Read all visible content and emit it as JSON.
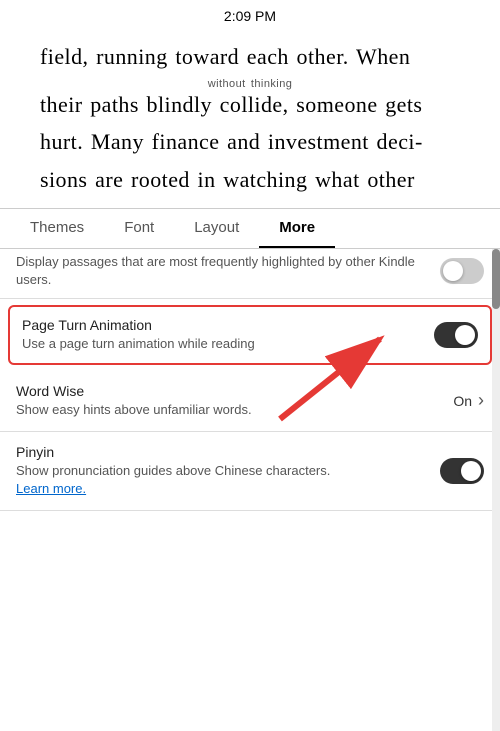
{
  "statusBar": {
    "time": "2:09 PM"
  },
  "bookContent": {
    "line1": "field, running toward each other. When",
    "annotation": "without thinking",
    "line2": "their paths blindly collide, someone gets",
    "line3": "hurt. Many finance and investment deci-",
    "line4": "sions are rooted in watching what other"
  },
  "tabs": {
    "items": [
      {
        "label": "Themes",
        "active": false
      },
      {
        "label": "Font",
        "active": false
      },
      {
        "label": "Layout",
        "active": false
      },
      {
        "label": "More",
        "active": true
      }
    ]
  },
  "settings": {
    "partialRow": {
      "desc": "Display passages that are most frequently highlighted by other Kindle users."
    },
    "pageTurnAnimation": {
      "title": "Page Turn Animation",
      "desc": "Use a page turn animation while reading",
      "enabled": true
    },
    "wordWise": {
      "title": "Word Wise",
      "desc": "Show easy hints above unfamiliar words.",
      "value": "On"
    },
    "pinyin": {
      "title": "Pinyin",
      "desc": "Show pronunciation guides above Chinese characters.",
      "learnMore": "Learn more.",
      "enabled": true
    }
  }
}
